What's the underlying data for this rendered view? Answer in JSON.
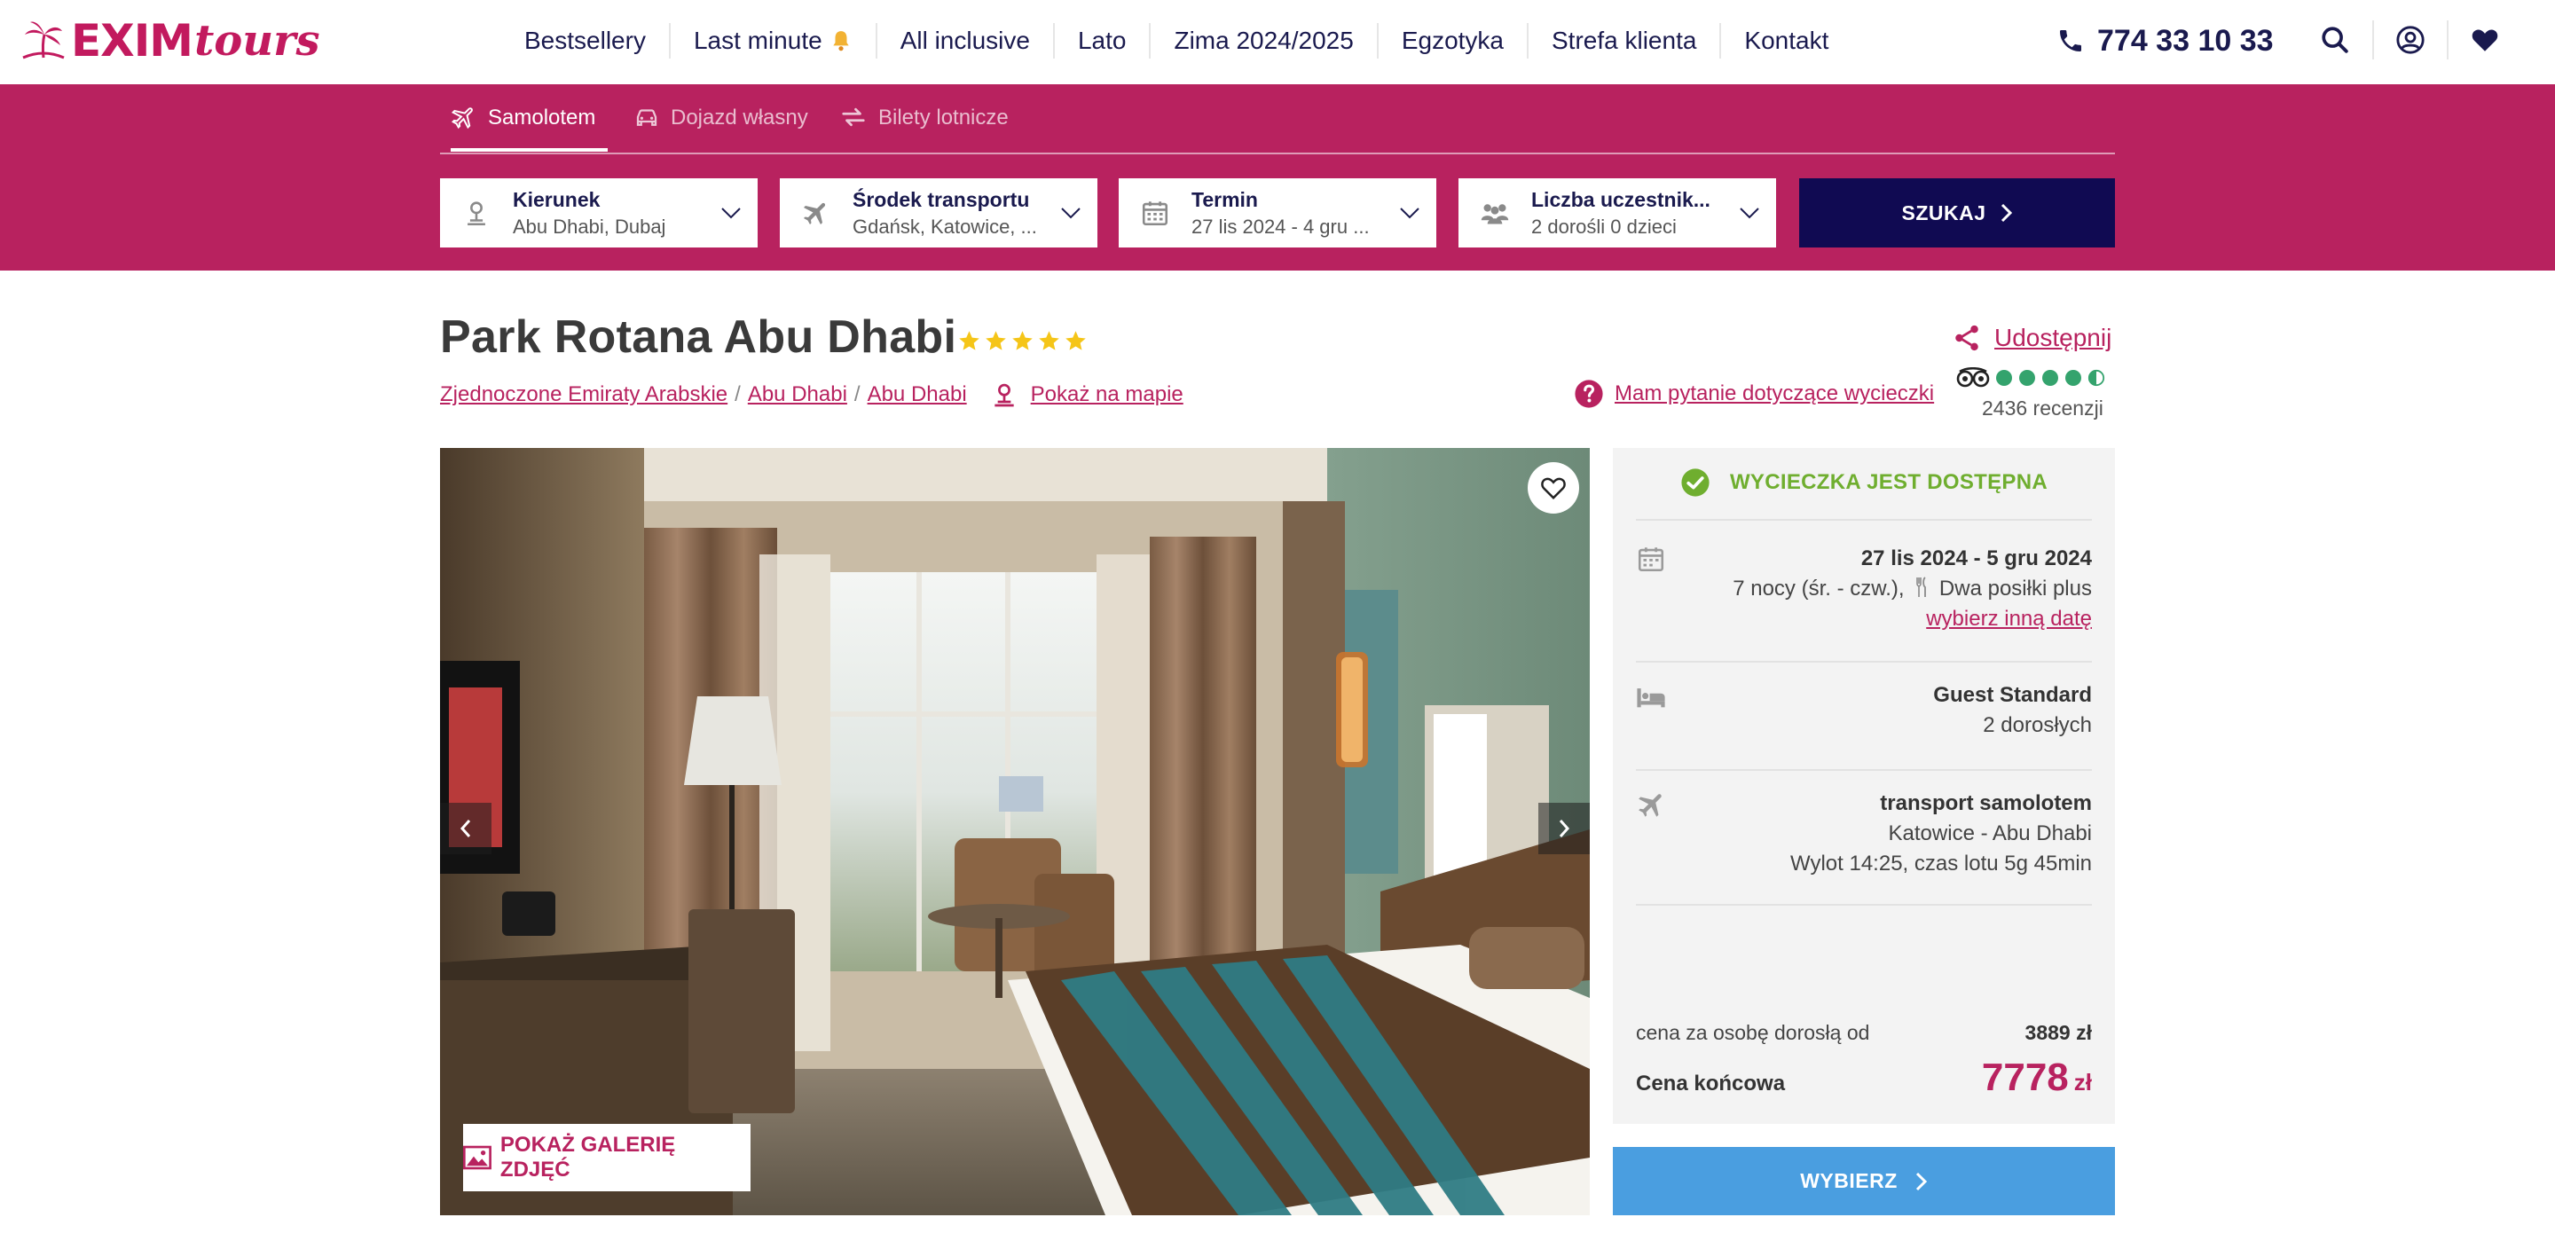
{
  "colors": {
    "brand": "#b8225f",
    "nav_text": "#1a1a4e",
    "search_button": "#100a52",
    "select_button": "#4a9ee0",
    "available": "#6fae2f"
  },
  "logo": {
    "text": "EXIM",
    "text2": "tours"
  },
  "nav": {
    "items": [
      "Bestsellery",
      "Last minute",
      "All inclusive",
      "Lato",
      "Zima 2024/2025",
      "Egzotyka",
      "Strefa klienta",
      "Kontakt"
    ],
    "phone": "774 33 10 33",
    "icons": [
      "search-icon",
      "user-icon",
      "heart-icon"
    ]
  },
  "search": {
    "tabs": [
      "Samolotem",
      "Dojazd własny",
      "Bilety lotnicze"
    ],
    "fields": [
      {
        "label": "Kierunek",
        "value": "Abu Dhabi, Dubaj",
        "icon": "location-icon"
      },
      {
        "label": "Środek transportu",
        "value": "Gdańsk, Katowice, ...",
        "icon": "plane-icon"
      },
      {
        "label": "Termin",
        "value": "27 lis 2024 - 4 gru ...",
        "icon": "calendar-icon"
      },
      {
        "label": "Liczba uczestnik...",
        "value": "2 dorośli 0 dzieci",
        "icon": "people-icon"
      }
    ],
    "button": "SZUKAJ"
  },
  "hotel": {
    "name": "Park Rotana Abu Dhabi",
    "stars": 5,
    "breadcrumb": [
      "Zjednoczone Emiraty Arabskie",
      "Abu Dhabi",
      "Abu Dhabi"
    ],
    "map_link": "Pokaż na mapie",
    "share": "Udostępnij",
    "question": "Mam pytanie dotyczące wycieczki",
    "tripadvisor_rating": 4.5,
    "reviews": "2436 recenzji"
  },
  "gallery": {
    "button": "POKAŻ GALERIĘ ZDJĘĆ"
  },
  "offer": {
    "status": "WYCIECZKA JEST DOSTĘPNA",
    "dates": "27 lis 2024 - 5 gru 2024",
    "nights": "7 nocy (śr. - czw.),",
    "board": "Dwa posiłki plus",
    "change_date": "wybierz inną datę",
    "room": "Guest Standard",
    "guests": "2 dorosłych",
    "transport": "transport samolotem",
    "route": "Katowice - Abu Dhabi",
    "flight": "Wylot 14:25, czas lotu 5g 45min",
    "price_per_person_label": "cena za osobę dorosłą od",
    "price_per_person": "3889 zł",
    "final_label": "Cena końcowa",
    "final_price": "7778",
    "currency": "zł",
    "select_button": "WYBIERZ"
  }
}
